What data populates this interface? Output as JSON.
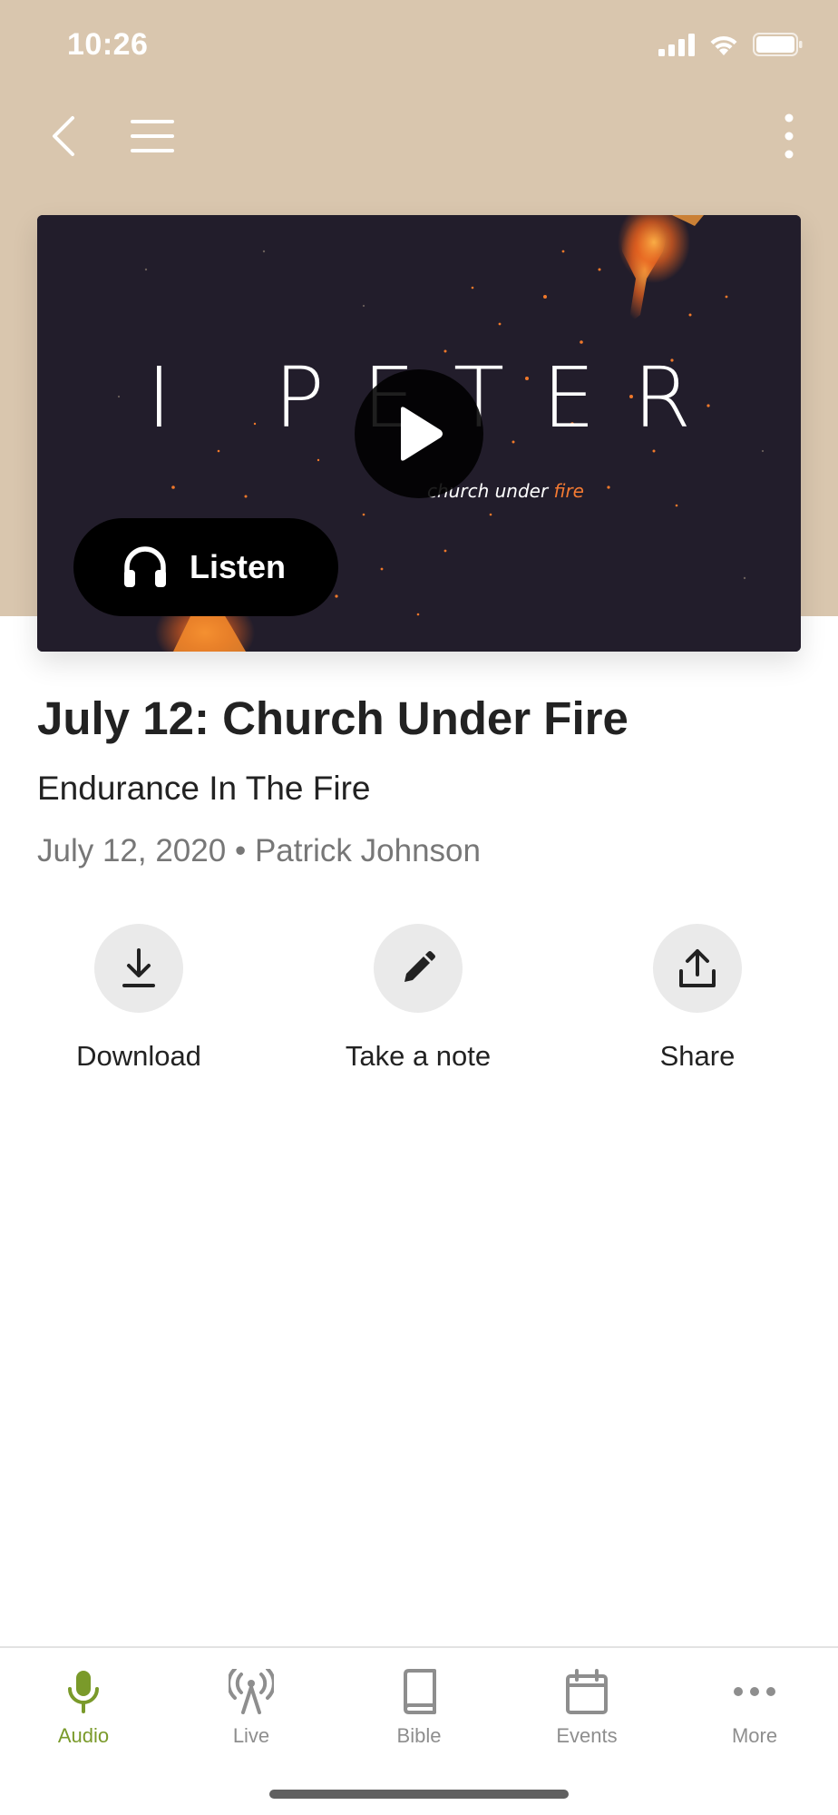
{
  "status_bar": {
    "time": "10:26"
  },
  "hero": {
    "series_title": "I PETER",
    "series_tagline_prefix": "church under ",
    "series_tagline_accent": "fire",
    "listen_label": "Listen"
  },
  "sermon": {
    "title": "July 12: Church Under Fire",
    "subtitle": "Endurance In The Fire",
    "date": "July 12, 2020",
    "separator": "•",
    "speaker": "Patrick Johnson"
  },
  "actions": [
    {
      "label": "Download",
      "icon": "download-icon"
    },
    {
      "label": "Take a note",
      "icon": "pencil-icon"
    },
    {
      "label": "Share",
      "icon": "share-icon"
    }
  ],
  "tabs": [
    {
      "label": "Audio",
      "icon": "microphone-icon",
      "active": true
    },
    {
      "label": "Live",
      "icon": "antenna-icon",
      "active": false
    },
    {
      "label": "Bible",
      "icon": "book-icon",
      "active": false
    },
    {
      "label": "Events",
      "icon": "calendar-icon",
      "active": false
    },
    {
      "label": "More",
      "icon": "ellipsis-icon",
      "active": false
    }
  ],
  "colors": {
    "header_bg": "#d9c6ae",
    "accent_active": "#7a9a2a",
    "fire_orange": "#f47a32",
    "hero_bg": "#221d2b"
  }
}
